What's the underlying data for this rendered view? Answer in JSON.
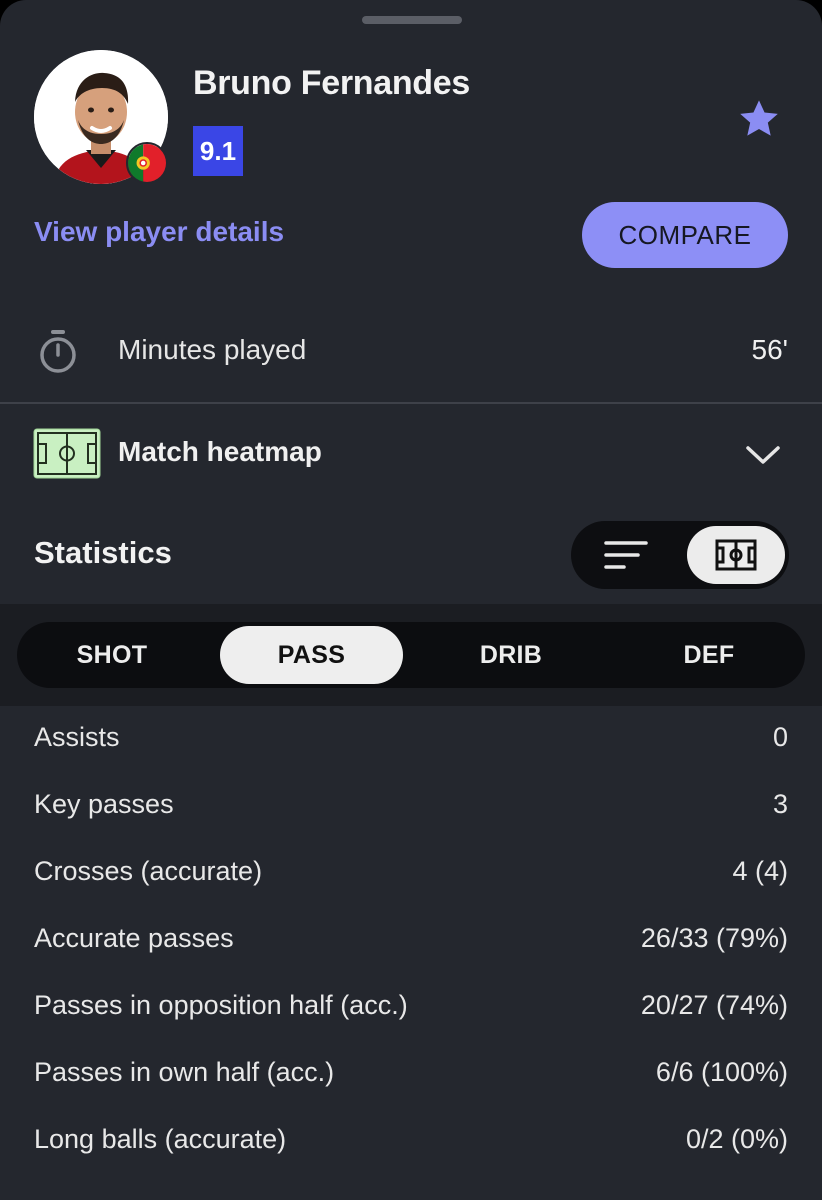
{
  "player": {
    "name": "Bruno Fernandes",
    "rating": "9.1",
    "nationality_flag": "portugal-flag",
    "view_details_label": "View player details",
    "compare_label": "COMPARE"
  },
  "minutes": {
    "label": "Minutes played",
    "value": "56'"
  },
  "heatmap": {
    "label": "Match heatmap"
  },
  "statistics": {
    "title": "Statistics",
    "view_modes": [
      "list",
      "pitch"
    ],
    "active_view": "pitch",
    "tabs": [
      {
        "label": "SHOT",
        "active": false
      },
      {
        "label": "PASS",
        "active": true
      },
      {
        "label": "DRIB",
        "active": false
      },
      {
        "label": "DEF",
        "active": false
      }
    ],
    "rows": [
      {
        "label": "Assists",
        "value": "0"
      },
      {
        "label": "Key passes",
        "value": "3"
      },
      {
        "label": "Crosses (accurate)",
        "value": "4 (4)"
      },
      {
        "label": "Accurate passes",
        "value": "26/33 (79%)"
      },
      {
        "label": "Passes in opposition half (acc.)",
        "value": "20/27 (74%)"
      },
      {
        "label": "Passes in own half (acc.)",
        "value": "6/6 (100%)"
      },
      {
        "label": "Long balls (accurate)",
        "value": "0/2 (0%)"
      }
    ]
  },
  "colors": {
    "background": "#24272e",
    "accent": "#8b8df3",
    "rating_badge": "#3a46e6",
    "heatmap_icon": "#c9f0c2"
  },
  "icons": [
    "stopwatch-icon",
    "pitch-icon",
    "chevron-down-icon",
    "star-icon",
    "list-view-icon",
    "pitch-view-icon"
  ]
}
